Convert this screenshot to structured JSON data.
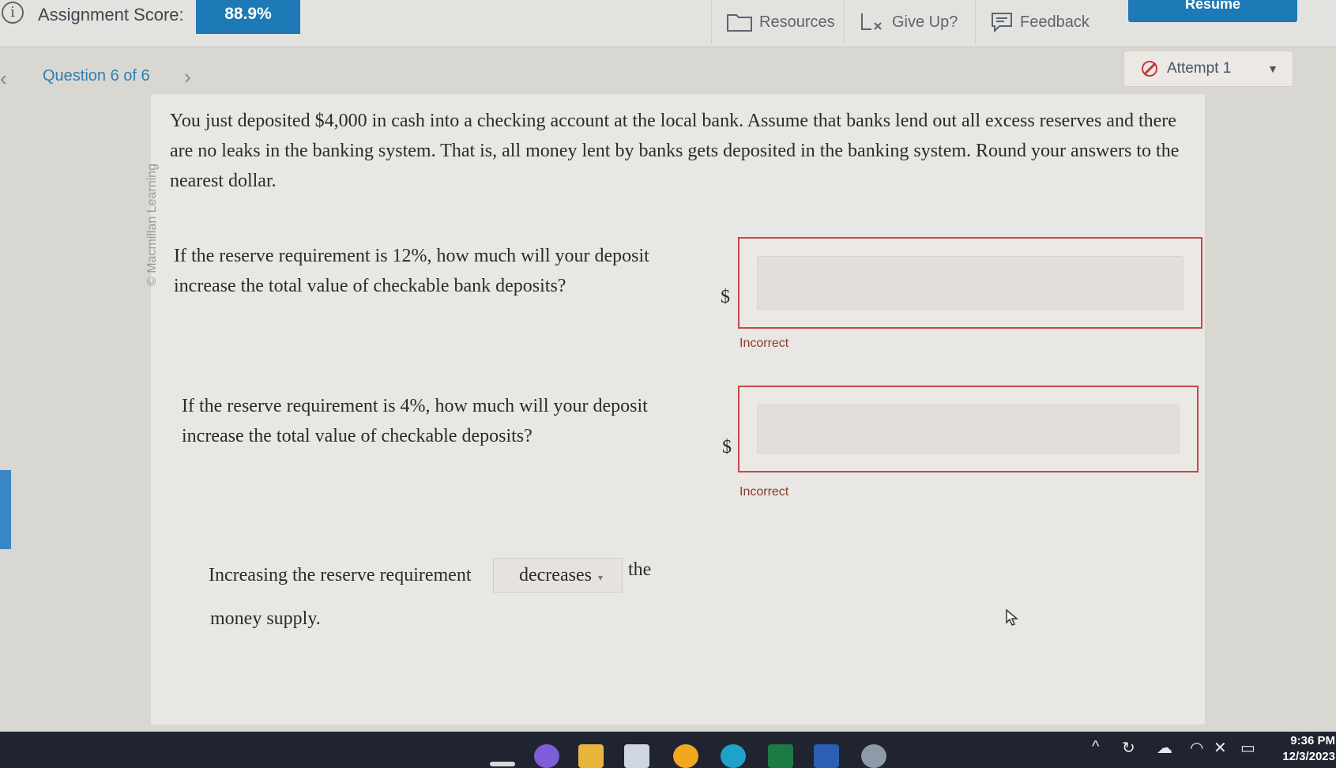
{
  "header": {
    "score_label": "Assignment Score:",
    "score_value": "88.9%",
    "resources_label": "Resources",
    "giveup_label": "Give Up?",
    "feedback_label": "Feedback",
    "resume_label": "Resume"
  },
  "question_nav": {
    "label": "Question 6 of 6",
    "attempt_label": "Attempt 1"
  },
  "publisher": "© Macmillan Learning",
  "intro_text": "You just deposited $4,000 in cash into a checking account at the local bank. Assume that banks lend out all excess reserves and there are no leaks in the banking system. That is, all money lent by banks gets deposited in the banking system. Round your answers to the nearest dollar.",
  "questions": [
    {
      "prompt": "If the reserve requirement is 12%, how much will your deposit increase the total value of checkable bank deposits?",
      "currency": "$",
      "value": "",
      "status": "Incorrect"
    },
    {
      "prompt": "If the reserve requirement is 4%, how much will your deposit increase the total value of checkable deposits?",
      "currency": "$",
      "value": "",
      "status": "Incorrect"
    }
  ],
  "sentence": {
    "before": "Increasing the reserve requirement",
    "selected": "decreases",
    "after": "the",
    "end": "money supply."
  },
  "taskbar": {
    "time": "9:36 PM",
    "date": "12/3/2023"
  },
  "colors": {
    "accent": "#1d7ab6",
    "error": "#c44a4a",
    "link": "#2f7fb2"
  }
}
